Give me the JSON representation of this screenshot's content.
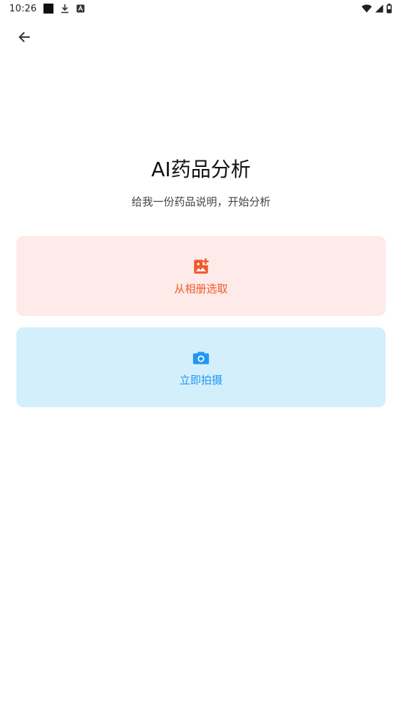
{
  "status_bar": {
    "time": "10:26",
    "icons": [
      "notification-square-icon",
      "download-icon",
      "keyboard-a-icon",
      "wifi-icon",
      "signal-icon",
      "battery-icon"
    ]
  },
  "header": {
    "back_icon": "arrow-left-icon"
  },
  "main": {
    "title": "AI药品分析",
    "subtitle": "给我一份药品说明，开始分析"
  },
  "options": {
    "album": {
      "label": "从相册选取",
      "icon": "add-photo-icon",
      "color": "#ef5a2d",
      "background": "#feeae8"
    },
    "camera": {
      "label": "立即拍摄",
      "icon": "camera-icon",
      "color": "#2196f3",
      "background": "#d3effc"
    }
  }
}
